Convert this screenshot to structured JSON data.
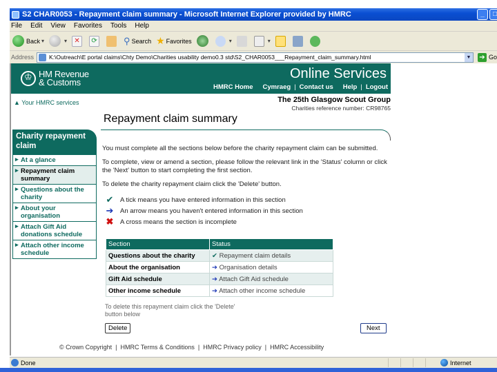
{
  "window": {
    "title": "S2 CHAR0053 - Repayment claim summary - Microsoft Internet Explorer provided by HMRC",
    "minimize_icon": "minimize-icon",
    "maximize_icon": "maximize-icon"
  },
  "menu": [
    "File",
    "Edit",
    "View",
    "Favorites",
    "Tools",
    "Help"
  ],
  "toolbar": {
    "back_label": "Back",
    "search_label": "Search",
    "favorites_label": "Favorites"
  },
  "address": {
    "label": "Address",
    "url": "K:\\Outreach\\E portal claims\\Chty Demo\\Charities usability demo0.3 std\\S2_CHAR0053___Repayment_claim_summary.html",
    "go_label": "Go"
  },
  "banner": {
    "logo_line1": "HM Revenue",
    "logo_line2": "& Customs",
    "service_title": "Online Services",
    "nav": [
      "HMRC Home",
      "Cymraeg",
      "Contact us",
      "Help",
      "Logout"
    ]
  },
  "your_services": "Your HMRC services",
  "charity": {
    "name": "The 25th Glasgow Scout Group",
    "reference": "Charities reference number: CR98765"
  },
  "page_title": "Repayment claim summary",
  "sidebar": {
    "heading": "Charity repayment claim",
    "items": [
      {
        "label": "At a glance",
        "active": false
      },
      {
        "label": "Repayment claim summary",
        "active": true
      },
      {
        "label": "Questions about the charity",
        "active": false
      },
      {
        "label": "About your organisation",
        "active": false
      },
      {
        "label": "Attach Gift Aid donations schedule",
        "active": false
      },
      {
        "label": "Attach other income schedule",
        "active": false
      }
    ]
  },
  "intro": {
    "p1": "You must complete all the sections below before the charity repayment claim can be submitted.",
    "p2": "To complete, view or amend a section, please follow the relevant link in the 'Status' column or click the 'Next' button to start completing the first section.",
    "p3": "To delete the charity repayment claim click the 'Delete' button."
  },
  "legend": [
    {
      "icon": "tick",
      "text": "A tick means you have entered information in this section"
    },
    {
      "icon": "arrow",
      "text": "An arrow means you haven't entered information in this section"
    },
    {
      "icon": "cross",
      "text": "A cross means the section is incomplete"
    }
  ],
  "table": {
    "headers": [
      "Section",
      "Status"
    ],
    "rows": [
      {
        "section": "Questions about the charity",
        "status_icon": "tick",
        "status": "Repayment claim details"
      },
      {
        "section": "About the organisation",
        "status_icon": "arrow",
        "status": "Organisation details"
      },
      {
        "section": "Gift Aid schedule",
        "status_icon": "arrow",
        "status": "Attach Gift Aid schedule"
      },
      {
        "section": "Other income schedule",
        "status_icon": "arrow",
        "status": "Attach other income schedule"
      }
    ]
  },
  "delete_note": "To delete this repayment claim click the 'Delete' button below",
  "buttons": {
    "delete": "Delete",
    "next": "Next"
  },
  "footer": [
    "© Crown Copyright",
    "HMRC Terms & Conditions",
    "HMRC Privacy policy",
    "HMRC Accessibility"
  ],
  "statusbar": {
    "status": "Done",
    "zone": "Internet"
  },
  "colors": {
    "brand": "#0e6a5f",
    "tick": "#0e6a5f",
    "arrow": "#1a35b5",
    "cross": "#d01010"
  }
}
